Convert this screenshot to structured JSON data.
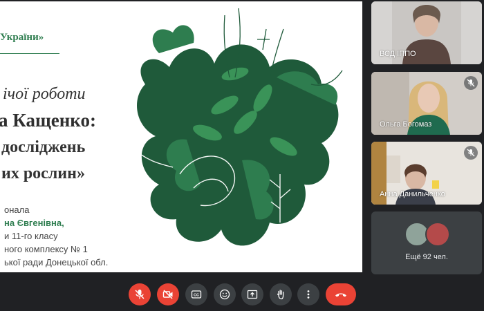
{
  "slide": {
    "header": "України»",
    "line1": "ічої роботи",
    "line2": "а Кащенко:",
    "line3": "досліджень",
    "line4": "их рослин»",
    "sub1": "онала",
    "sub2": "на Євгенівна,",
    "sub3": "и 11-го класу",
    "sub4": "ного комплексу № 1",
    "sub5": "ької ради Донецької обл."
  },
  "participants": [
    {
      "name": "ВСД ІППО",
      "muted": false
    },
    {
      "name": "Ольга Богомаз",
      "muted": true
    },
    {
      "name": "Анна Данильченко",
      "muted": true
    }
  ],
  "others": {
    "label": "Ещё 92 чел."
  },
  "controls": [
    {
      "icon": "mic-off-icon",
      "active_red": true
    },
    {
      "icon": "camera-off-icon",
      "active_red": true
    },
    {
      "icon": "captions-icon",
      "active_red": false
    },
    {
      "icon": "emoji-icon",
      "active_red": false
    },
    {
      "icon": "present-icon",
      "active_red": false
    },
    {
      "icon": "raise-hand-icon",
      "active_red": false
    },
    {
      "icon": "more-icon",
      "active_red": false
    },
    {
      "icon": "end-call-icon",
      "active_red": true
    }
  ],
  "colors": {
    "background": "#202124",
    "control": "#3c4043",
    "danger": "#ea4335",
    "accent": "#2e7d4f"
  }
}
